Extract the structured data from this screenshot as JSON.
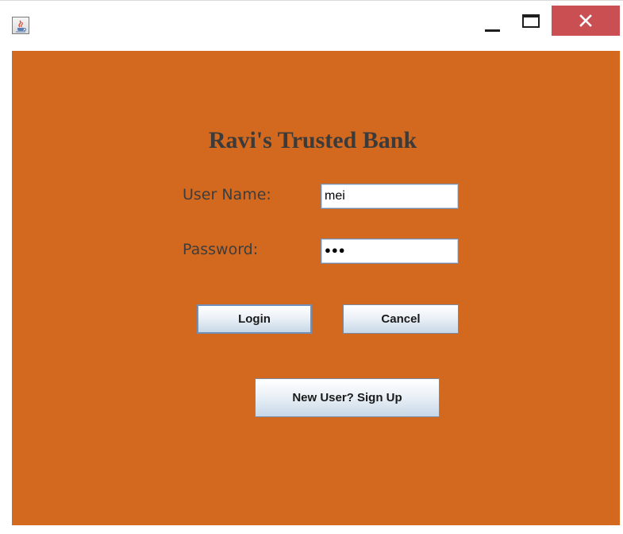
{
  "window": {
    "title_icon": "java-cup-icon",
    "controls": {
      "minimize_icon": "minimize-icon",
      "maximize_icon": "maximize-icon",
      "close_icon": "close-icon"
    }
  },
  "form": {
    "title": "Ravi's Trusted Bank",
    "username_label": "User Name:",
    "username_value": "mei",
    "password_label": "Password:",
    "password_masked": "●●●",
    "login_label": "Login",
    "cancel_label": "Cancel",
    "signup_label": "New User? Sign Up"
  },
  "colors": {
    "panel_background": "#d2691f",
    "close_button": "#c94f52",
    "title_text": "#3b3b3b"
  }
}
